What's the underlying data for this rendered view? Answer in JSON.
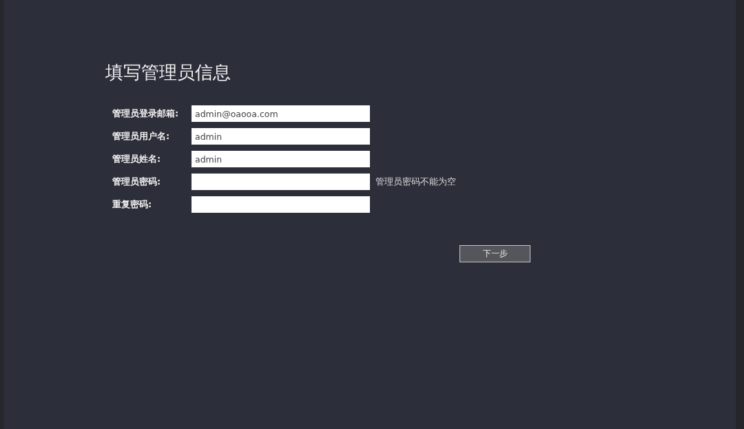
{
  "title": "填写管理员信息",
  "fields": [
    {
      "label": "管理员登录邮箱:",
      "value": "admin@oaooa.com"
    },
    {
      "label": "管理员用户名:",
      "value": "admin"
    },
    {
      "label": "管理员姓名:",
      "value": "admin"
    },
    {
      "label": "管理员密码:",
      "error": "管理员密码不能为空"
    },
    {
      "label": "重复密码:"
    }
  ],
  "next_button": "下一步"
}
